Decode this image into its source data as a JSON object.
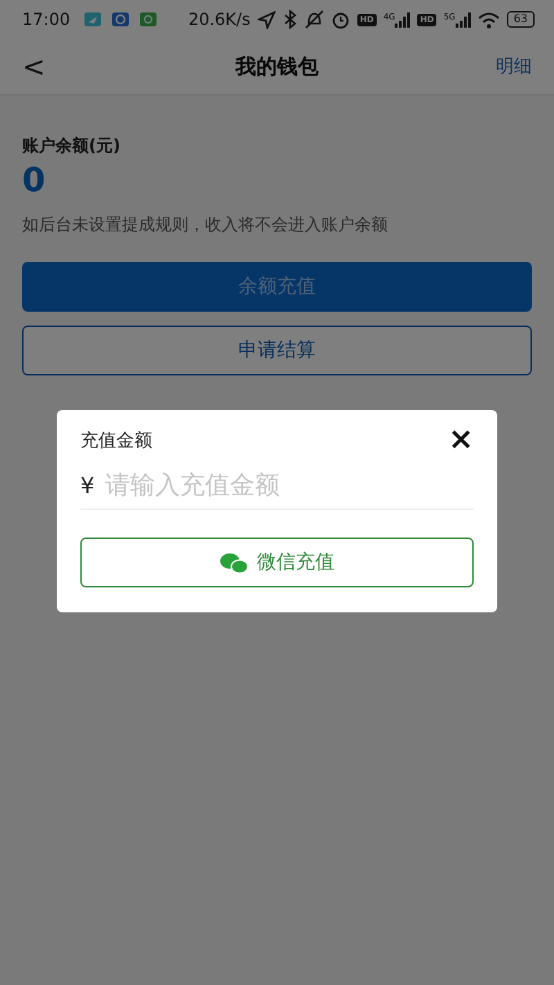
{
  "status_bar": {
    "time": "17:00",
    "speed": "20.6K/s",
    "net_labels": [
      "HD",
      "4G",
      "HD",
      "5G"
    ],
    "battery": "63"
  },
  "header": {
    "back": "<",
    "title": "我的钱包",
    "action": "明细"
  },
  "balance": {
    "label": "账户余额(元)",
    "amount": "0",
    "note": "如后台未设置提成规则，收入将不会进入账户余额"
  },
  "buttons": [
    {
      "label": "余额充值",
      "kind": "primary"
    },
    {
      "label": "申请结算",
      "kind": "outline"
    }
  ],
  "dialog": {
    "title": "充值金额",
    "close": "×",
    "currency": "¥",
    "placeholder": "请输入充值金额",
    "pay_button": "微信充值"
  }
}
